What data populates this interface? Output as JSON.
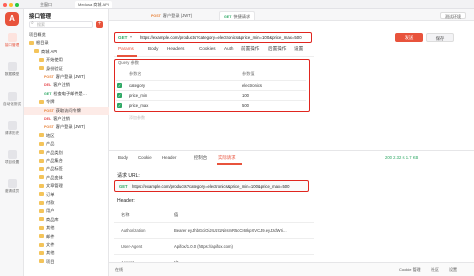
{
  "window": {
    "tabs": [
      "主窗口",
      "Medusa 商城 API"
    ]
  },
  "rail": {
    "logo": "A",
    "items": [
      "接口管理",
      "数据模型",
      "自动化测试",
      "请求历史",
      "项目设置",
      "邀请成员"
    ]
  },
  "tree": {
    "title": "接口管理",
    "search_placeholder": "搜索",
    "add_label": "+",
    "rows": [
      {
        "method": "",
        "label": "项目概览",
        "indent": 0,
        "folder": false
      },
      {
        "method": "",
        "label": "根目录",
        "indent": 0,
        "folder": true
      },
      {
        "method": "",
        "label": "商城 API",
        "indent": 1,
        "folder": true
      },
      {
        "method": "",
        "label": "开始使用",
        "indent": 2,
        "folder": true
      },
      {
        "method": "",
        "label": "身份验证",
        "indent": 2,
        "folder": true
      },
      {
        "method": "POST",
        "label": "客户登录 (JWT)",
        "indent": 3,
        "folder": false
      },
      {
        "method": "DEL",
        "label": "客户注销",
        "indent": 3,
        "folder": false
      },
      {
        "method": "GET",
        "label": "检查电子邮件是…",
        "indent": 3,
        "folder": false
      },
      {
        "method": "",
        "label": "令牌",
        "indent": 2,
        "folder": true
      },
      {
        "method": "POST",
        "label": "获取访问令牌",
        "indent": 3,
        "folder": false
      },
      {
        "method": "DEL",
        "label": "客户注销",
        "indent": 3,
        "folder": false
      },
      {
        "method": "POST",
        "label": "客户登录 (JWT)",
        "indent": 3,
        "folder": false
      },
      {
        "method": "",
        "label": "地区",
        "indent": 2,
        "folder": true
      },
      {
        "method": "",
        "label": "产品",
        "indent": 2,
        "folder": true
      },
      {
        "method": "",
        "label": "产品类别",
        "indent": 2,
        "folder": true
      },
      {
        "method": "",
        "label": "产品集合",
        "indent": 2,
        "folder": true
      },
      {
        "method": "",
        "label": "产品标签",
        "indent": 2,
        "folder": true
      },
      {
        "method": "",
        "label": "产品变体",
        "indent": 2,
        "folder": true
      },
      {
        "method": "",
        "label": "文章管理",
        "indent": 2,
        "folder": true
      },
      {
        "method": "",
        "label": "订单",
        "indent": 2,
        "folder": true
      },
      {
        "method": "",
        "label": "付款",
        "indent": 2,
        "folder": true
      },
      {
        "method": "",
        "label": "用户",
        "indent": 2,
        "folder": true
      },
      {
        "method": "",
        "label": "商品库",
        "indent": 2,
        "folder": true
      },
      {
        "method": "",
        "label": "其他",
        "indent": 2,
        "folder": true
      },
      {
        "method": "",
        "label": "邮件",
        "indent": 2,
        "folder": true
      },
      {
        "method": "",
        "label": "文件",
        "indent": 2,
        "folder": true
      },
      {
        "method": "",
        "label": "其他",
        "indent": 2,
        "folder": true
      },
      {
        "method": "",
        "label": "项目",
        "indent": 2,
        "folder": true
      }
    ]
  },
  "top_tabs": [
    {
      "method": "POST",
      "label": "客户登录 (JWT)"
    },
    {
      "method": "GET",
      "label": "快捷请求"
    }
  ],
  "env_label": "测试环境",
  "request": {
    "method": "GET",
    "url": "https://example.com/products?category=electronics&price_min=100&price_max=500",
    "send_label": "发送",
    "save_label": "保存",
    "subtabs": [
      "Params",
      "Body",
      "Headers",
      "Cookies",
      "Auth",
      "前置操作",
      "后置操作",
      "设置"
    ],
    "query_title": "Query 参数",
    "param_header": {
      "name": "参数名",
      "value": "参数值"
    },
    "params": [
      {
        "name": "category",
        "value": "electronics"
      },
      {
        "name": "price_min",
        "value": "100"
      },
      {
        "name": "price_max",
        "value": "500"
      }
    ],
    "add_param_placeholder": "添加参数"
  },
  "response": {
    "tabs": [
      "Body",
      "Cookie",
      "Header",
      "控制台",
      "实际请求"
    ],
    "active_tab_index": 4,
    "status": "200  2.32 s  1.7 KB",
    "url_label": "请求 URL:",
    "method": "GET",
    "url": "https://example.com/products?category=electronics&price_min=100&price_max=500",
    "header_label": "Header:",
    "header_cols": {
      "name": "名称",
      "value": "值"
    },
    "headers": [
      {
        "name": "Authorization",
        "value": "Bearer eyJhbGciOiJIUzI1NiIsInR5cCI6IkpXVCJ9.eyJzdWIi…"
      },
      {
        "name": "User-Agent",
        "value": "Apifox/1.0.0 (https://apifox.com)"
      },
      {
        "name": "Accept",
        "value": "*/*"
      }
    ]
  },
  "statusbar": {
    "left": "在线",
    "items": [
      "Cookie 管理",
      "社区",
      "设置"
    ]
  }
}
